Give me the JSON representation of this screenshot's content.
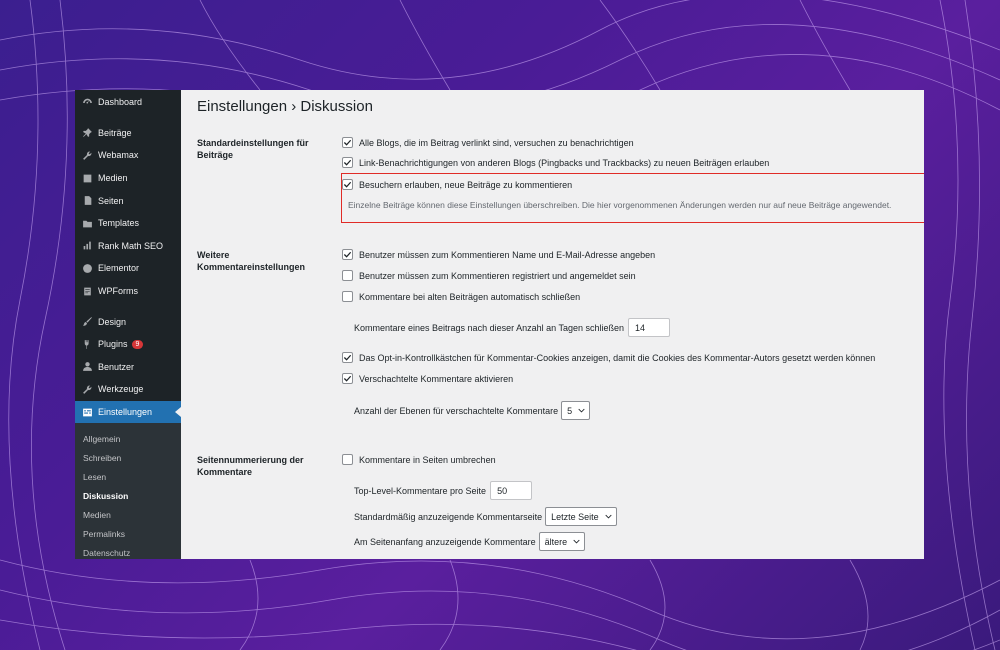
{
  "page_title": "Einstellungen › Diskussion",
  "sidebar": {
    "items": [
      {
        "label": "Dashboard",
        "icon": "dashboard-icon"
      },
      {
        "label": "Beiträge",
        "icon": "pin-icon"
      },
      {
        "label": "Webamax",
        "icon": "wrench-icon"
      },
      {
        "label": "Medien",
        "icon": "media-icon"
      },
      {
        "label": "Seiten",
        "icon": "pages-icon"
      },
      {
        "label": "Templates",
        "icon": "folder-icon"
      },
      {
        "label": "Rank Math SEO",
        "icon": "chart-icon"
      },
      {
        "label": "Elementor",
        "icon": "elementor-icon"
      },
      {
        "label": "WPForms",
        "icon": "forms-icon"
      },
      {
        "label": "Design",
        "icon": "brush-icon"
      },
      {
        "label": "Plugins",
        "icon": "plug-icon",
        "badge": "9"
      },
      {
        "label": "Benutzer",
        "icon": "user-icon"
      },
      {
        "label": "Werkzeuge",
        "icon": "tools-icon"
      },
      {
        "label": "Einstellungen",
        "icon": "settings-icon"
      }
    ],
    "submenu": [
      "Allgemein",
      "Schreiben",
      "Lesen",
      "Diskussion",
      "Medien",
      "Permalinks",
      "Datenschutz"
    ]
  },
  "sections": {
    "standard": {
      "label": "Standardeinstellungen für Beiträge",
      "options": [
        {
          "label": "Alle Blogs, die im Beitrag verlinkt sind, versuchen zu benachrichtigen",
          "checked": true
        },
        {
          "label": "Link-Benachrichtigungen von anderen Blogs (Pingbacks und Trackbacks) zu neuen Beiträgen erlauben",
          "checked": true
        },
        {
          "label": "Besuchern erlauben, neue Beiträge zu kommentieren",
          "checked": true
        }
      ],
      "note": "Einzelne Beiträge können diese Einstellungen überschreiben. Die hier vorgenommenen Änderungen werden nur auf neue Beiträge angewendet."
    },
    "weitere": {
      "label": "Weitere Kommentareinstellungen",
      "options": [
        {
          "label": "Benutzer müssen zum Kommentieren Name und E-Mail-Adresse angeben",
          "checked": true
        },
        {
          "label": "Benutzer müssen zum Kommentieren registriert und angemeldet sein",
          "checked": false
        },
        {
          "label": "Kommentare bei alten Beiträgen automatisch schließen",
          "checked": false
        },
        {
          "label": "Das Opt-in-Kontrollkästchen für Kommentar-Cookies anzeigen, damit die Cookies des Kommentar-Autors gesetzt werden können",
          "checked": true
        },
        {
          "label": "Verschachtelte Kommentare aktivieren",
          "checked": true
        }
      ],
      "close_days_label": "Kommentare eines Beitrags nach dieser Anzahl an Tagen schließen",
      "close_days_value": "14",
      "nesting_label": "Anzahl der Ebenen für verschachtelte Kommentare",
      "nesting_value": "5"
    },
    "paging": {
      "label": "Seitennummerierung der Kommentare",
      "option": {
        "label": "Kommentare in Seiten umbrechen",
        "checked": false
      },
      "per_page_label": "Top-Level-Kommentare pro Seite",
      "per_page_value": "50",
      "default_page_label": "Standardmäßig anzuzeigende Kommentarseite",
      "default_page_value": "Letzte Seite",
      "order_label": "Am Seitenanfang anzuzeigende Kommentare",
      "order_value": "ältere"
    }
  },
  "colors": {
    "admin_bar": "#1d2327",
    "accent": "#2271b1",
    "highlight_border": "#e02b27",
    "content_bg": "#f0f0f1",
    "background": "#4a1c96"
  }
}
